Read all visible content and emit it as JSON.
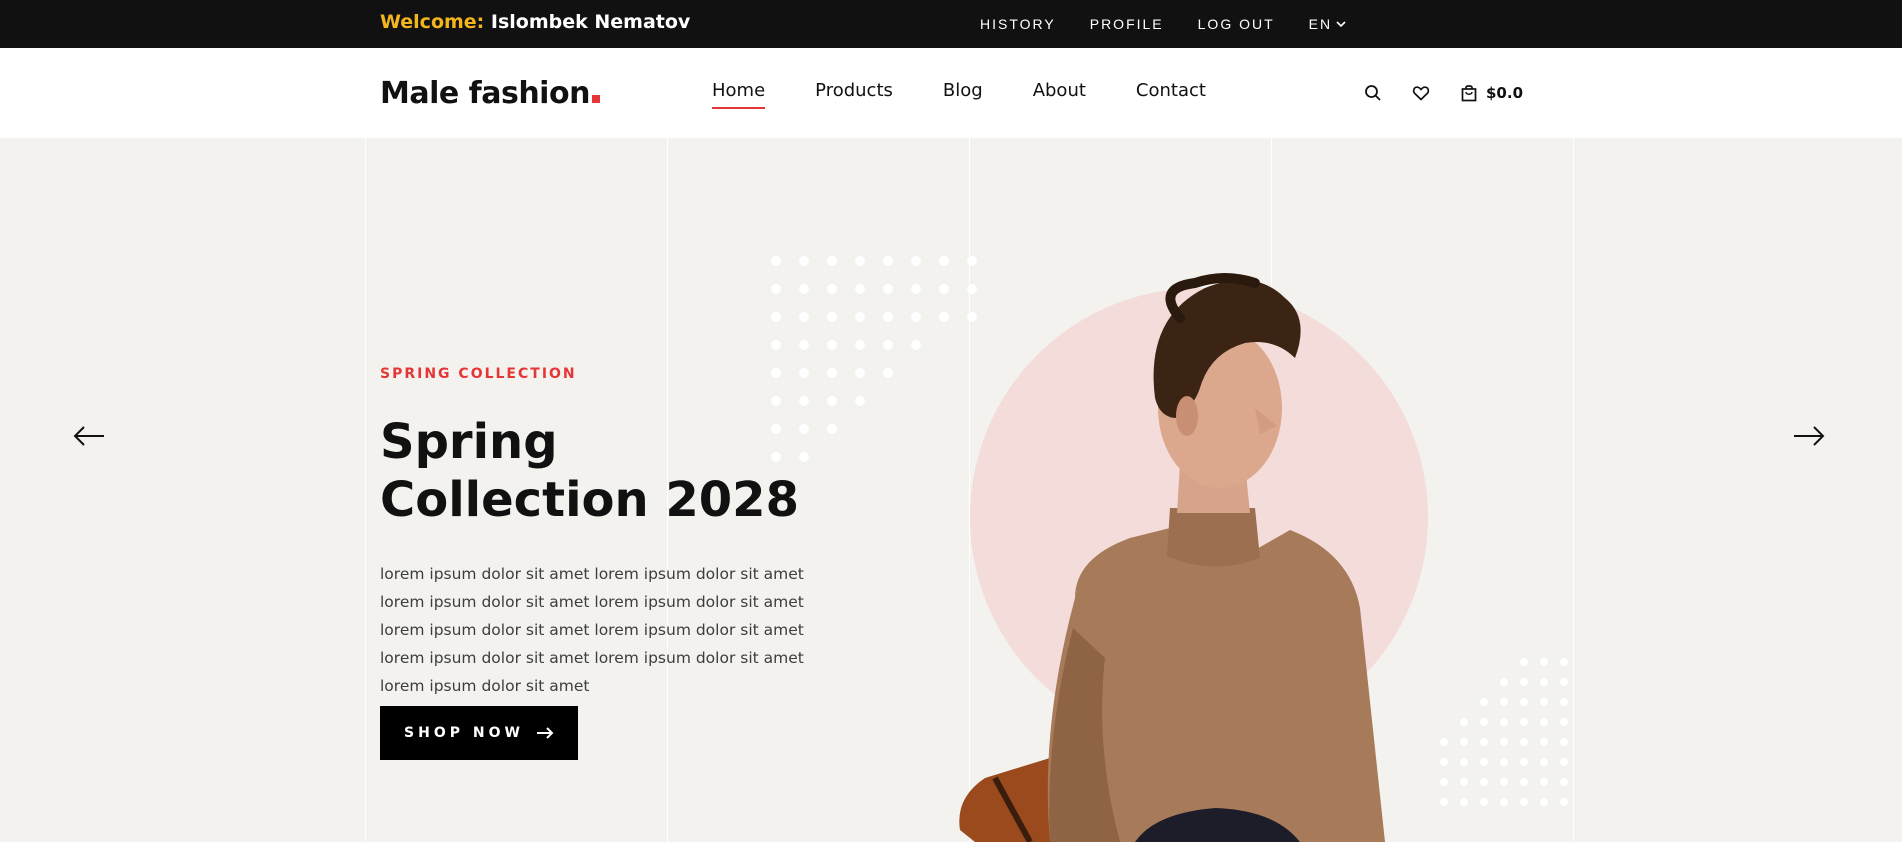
{
  "topbar": {
    "welcome_label": "Welcome:",
    "user_name": "Islombek Nematov",
    "links": [
      "HISTORY",
      "PROFILE",
      "LOG OUT"
    ],
    "language": "EN"
  },
  "header": {
    "logo_text": "Male fashion",
    "nav": [
      {
        "label": "Home",
        "active": true
      },
      {
        "label": "Products",
        "active": false
      },
      {
        "label": "Blog",
        "active": false
      },
      {
        "label": "About",
        "active": false
      },
      {
        "label": "Contact",
        "active": false
      }
    ],
    "icons": [
      "search-icon",
      "heart-icon",
      "shopping-bag-icon"
    ],
    "cart_total": "$0.0"
  },
  "hero": {
    "kicker": "SPRING COLLECTION",
    "title": "Spring Collection 2028",
    "text": "lorem ipsum dolor sit amet lorem ipsum dolor sit amet lorem ipsum dolor sit amet lorem ipsum dolor sit amet lorem ipsum dolor sit amet lorem ipsum dolor sit amet lorem ipsum dolor sit amet lorem ipsum dolor sit amet lorem ipsum dolor sit amet",
    "button_label": "SHOP NOW",
    "prev_icon": "arrow-left-icon",
    "next_icon": "arrow-right-icon"
  },
  "colors": {
    "accent": "#e53637",
    "welcome": "#f3b51b",
    "topbar_bg": "#111111",
    "hero_bg": "#f3f2ee",
    "circle": "#f4dcdb"
  }
}
